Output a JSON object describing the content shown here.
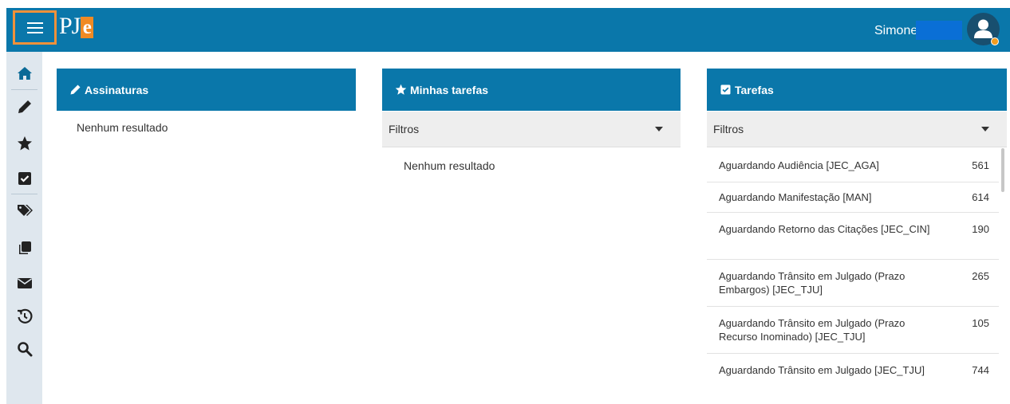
{
  "header": {
    "logo_text": "PJ",
    "logo_accent": "e",
    "user_name": "Simone",
    "menu_icon": "hamburger-menu-icon",
    "avatar_icon": "user-avatar-icon",
    "colors": {
      "bar": "#0a77aa",
      "accent": "#f08a24",
      "menu_highlight": "#f0913a"
    }
  },
  "sidebar": {
    "items": [
      {
        "icon": "home-icon"
      },
      {
        "icon": "pencil-icon"
      },
      {
        "icon": "star-icon"
      },
      {
        "icon": "checkbox-icon"
      },
      {
        "icon": "tags-icon"
      },
      {
        "icon": "copy-icon"
      },
      {
        "icon": "envelope-icon"
      },
      {
        "icon": "history-icon"
      },
      {
        "icon": "search-icon"
      }
    ]
  },
  "panels": {
    "assinaturas": {
      "title": "Assinaturas",
      "icon": "pencil-icon",
      "empty": "Nenhum resultado"
    },
    "minhas_tarefas": {
      "title": "Minhas tarefas",
      "icon": "star-icon",
      "filter": "Filtros",
      "empty": "Nenhum resultado"
    },
    "tarefas": {
      "title": "Tarefas",
      "icon": "checkbox-icon",
      "filter": "Filtros",
      "items": [
        {
          "name": "Aguardando Audiência [JEC_AGA]",
          "count": "561"
        },
        {
          "name": "Aguardando Manifestação [MAN]",
          "count": "614"
        },
        {
          "name": "Aguardando Retorno das Citações [JEC_CIN]",
          "count": "190"
        },
        {
          "name": "Aguardando Trânsito em Julgado (Prazo Embargos) [JEC_TJU]",
          "count": "265"
        },
        {
          "name": "Aguardando Trânsito em Julgado (Prazo Recurso Inominado) [JEC_TJU]",
          "count": "105"
        },
        {
          "name": "Aguardando Trânsito em Julgado [JEC_TJU]",
          "count": "744"
        }
      ]
    }
  }
}
